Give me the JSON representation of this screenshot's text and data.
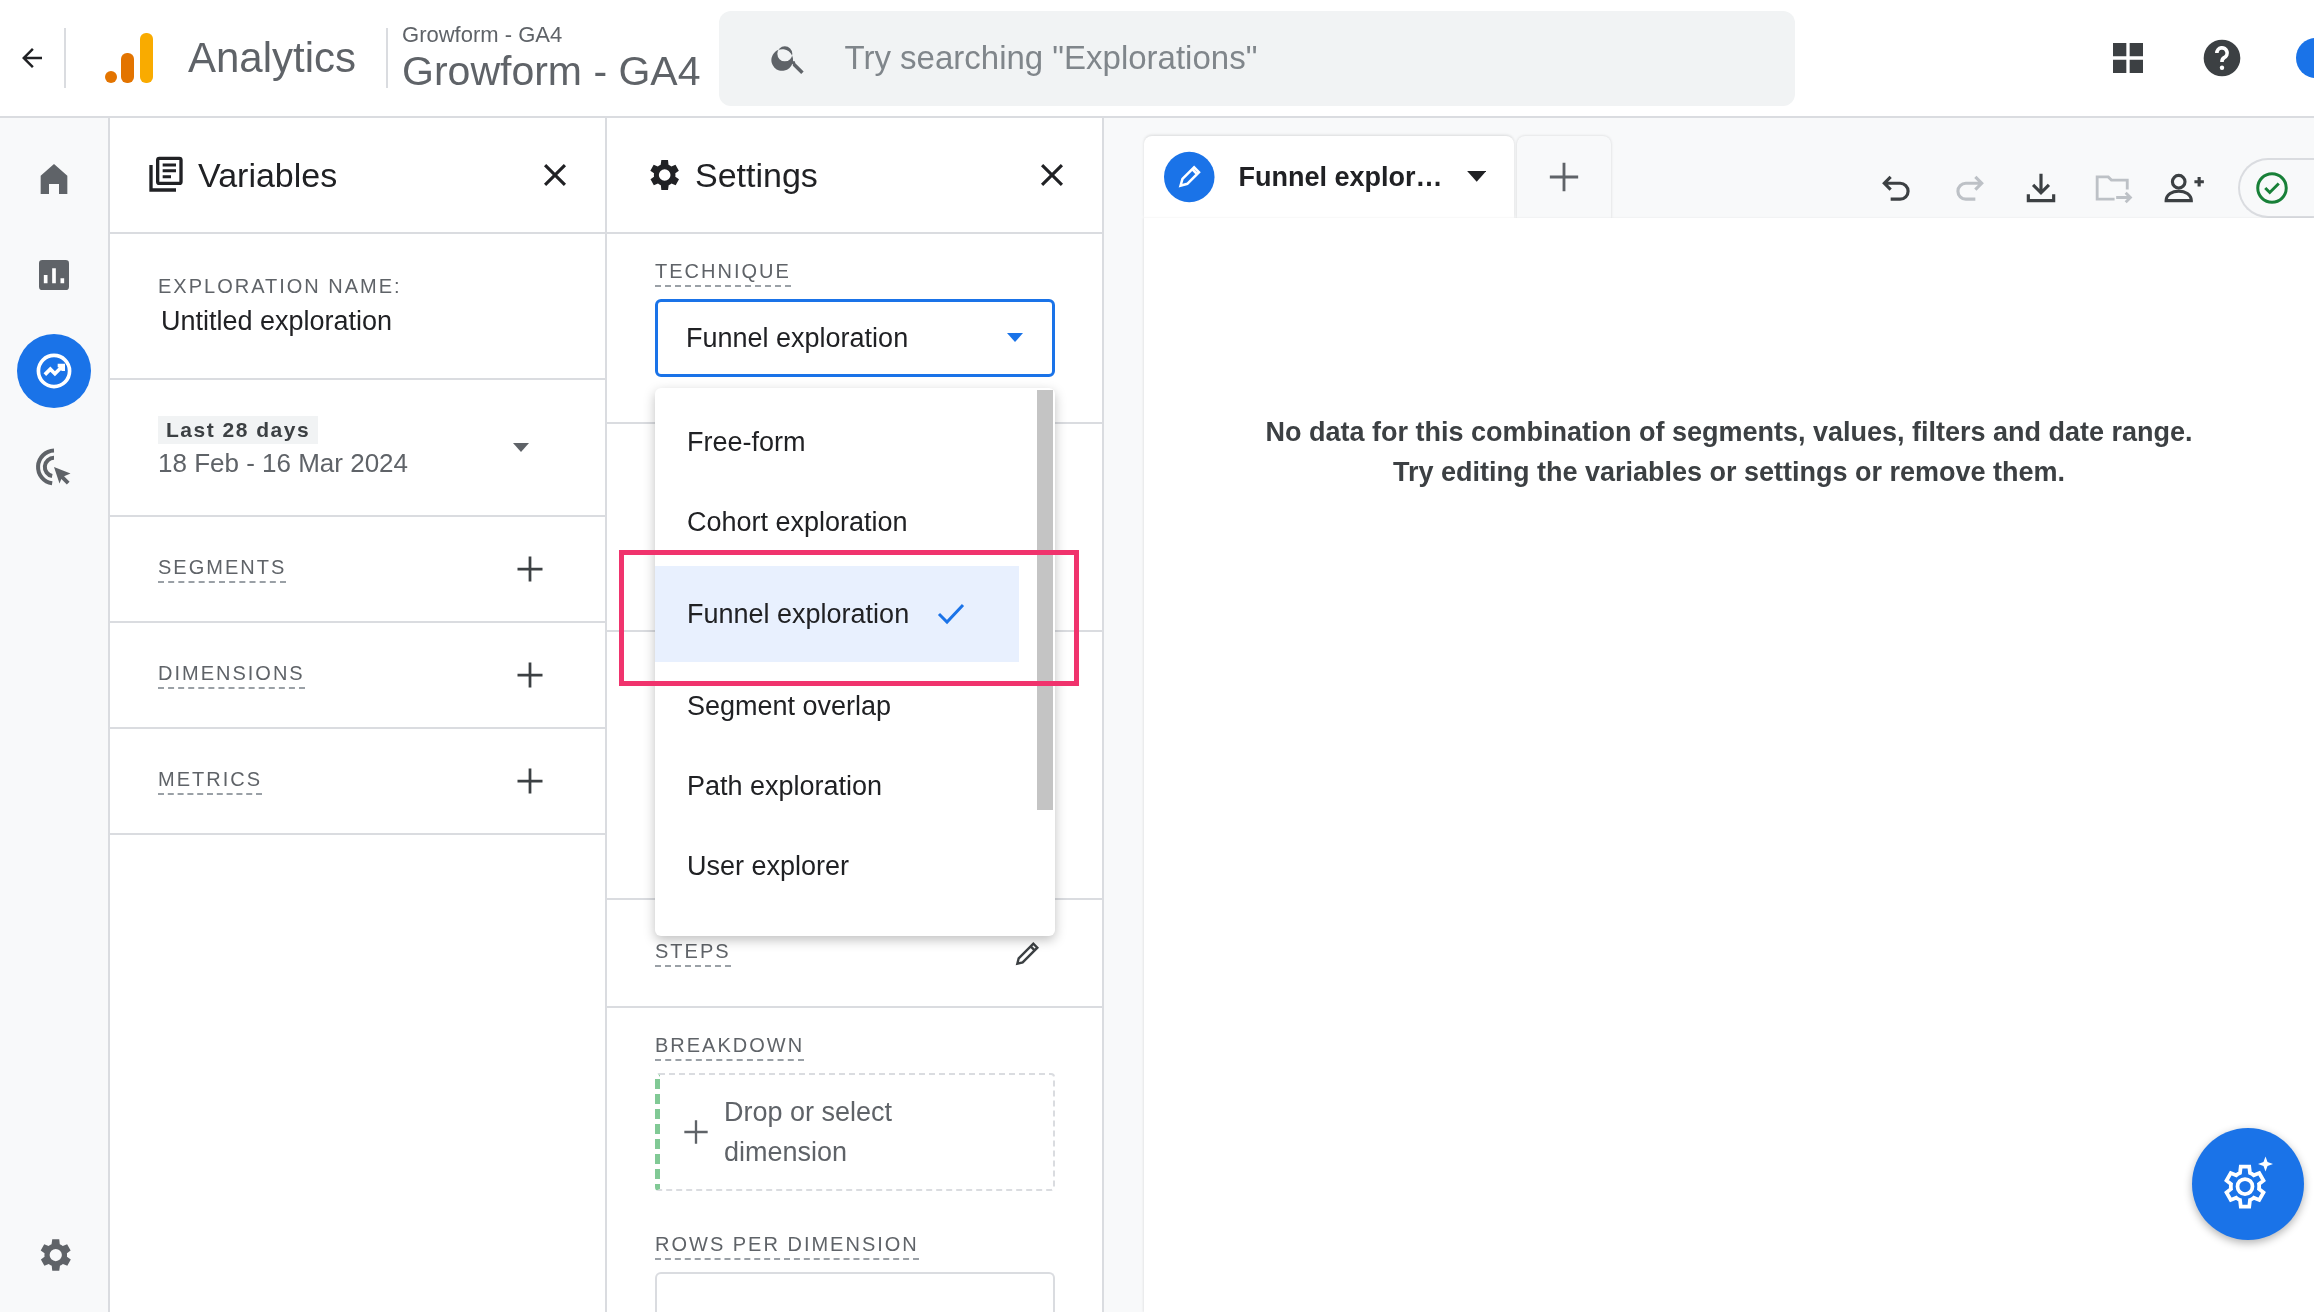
{
  "header": {
    "app_name": "Analytics",
    "property_caption": "Growform - GA4",
    "property_name": "Growform - GA4",
    "search": {
      "placeholder": "Try searching \"Explorations\""
    }
  },
  "nav_rail": {
    "items": [
      {
        "kind": "home",
        "selected": false
      },
      {
        "kind": "reports",
        "selected": false
      },
      {
        "kind": "explore",
        "selected": true
      },
      {
        "kind": "advertising",
        "selected": false
      }
    ]
  },
  "variables_panel": {
    "title": "Variables",
    "exploration_name_label": "EXPLORATION NAME:",
    "exploration_name": "Untitled exploration",
    "date_preset": "Last 28 days",
    "date_range": "18 Feb - 16 Mar 2024",
    "sections": [
      "SEGMENTS",
      "DIMENSIONS",
      "METRICS"
    ]
  },
  "settings_panel": {
    "title": "Settings",
    "technique_label": "TECHNIQUE",
    "technique_value": "Funnel exploration",
    "technique_options": [
      {
        "label": "Free-form",
        "selected": false
      },
      {
        "label": "Cohort exploration",
        "selected": false
      },
      {
        "label": "Funnel exploration",
        "selected": true
      },
      {
        "label": "Segment overlap",
        "selected": false
      },
      {
        "label": "Path exploration",
        "selected": false
      },
      {
        "label": "User explorer",
        "selected": false
      }
    ],
    "steps_label": "STEPS",
    "breakdown_label": "BREAKDOWN",
    "breakdown_placeholder": "Drop or select dimension",
    "rows_per_dimension_label": "ROWS PER DIMENSION"
  },
  "tabs": [
    {
      "label": "Funnel explor…",
      "selected": true
    }
  ],
  "toolbar": [
    {
      "kind": "undo",
      "disabled": false
    },
    {
      "kind": "redo",
      "disabled": true
    },
    {
      "kind": "download",
      "disabled": false
    },
    {
      "kind": "move",
      "disabled": true
    },
    {
      "kind": "share",
      "disabled": false
    }
  ],
  "empty_message": [
    "No data for this combination of segments, values, filters and date range.",
    "Try editing the variables or settings or remove them."
  ]
}
